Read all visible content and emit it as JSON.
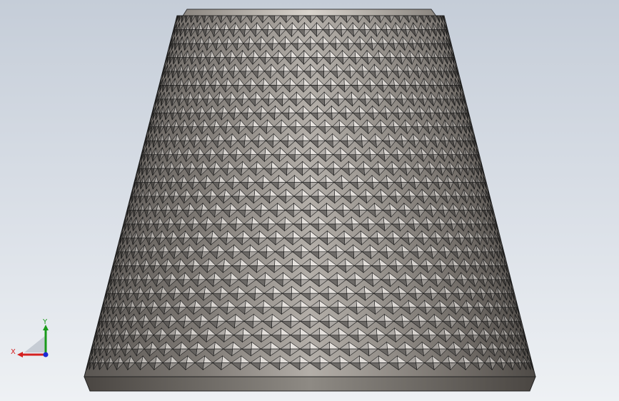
{
  "viewport": {
    "background_top": "#c5cdd8",
    "background_bottom": "#eef1f4"
  },
  "model": {
    "shape": "truncated-cone-with-knurled-diamond-pattern",
    "base_color": "#8a8580",
    "highlight_color": "#f2efea",
    "edge_color": "#1a1a1a"
  },
  "triad": {
    "x_label": "X",
    "y_label": "Y",
    "x_color": "#d42020",
    "y_color": "#1a9a1a",
    "z_color": "#1a2ad4"
  }
}
